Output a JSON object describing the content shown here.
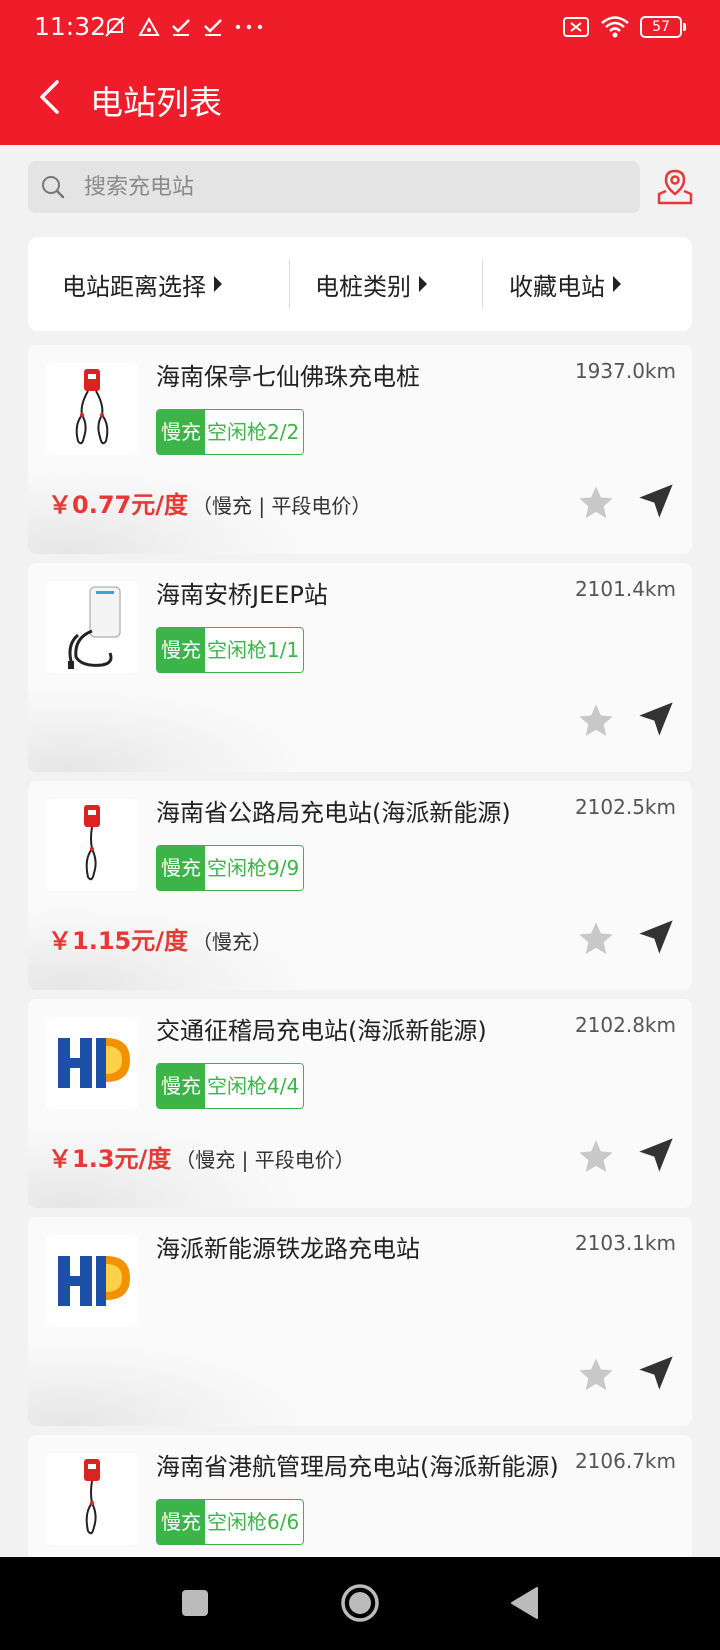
{
  "status_bar": {
    "time": "11:32",
    "battery": "57"
  },
  "header": {
    "title": "电站列表"
  },
  "search": {
    "placeholder": "搜索充电站"
  },
  "filters": [
    {
      "label": "电站距离选择"
    },
    {
      "label": "电桩类别"
    },
    {
      "label": "收藏电站"
    }
  ],
  "stations": [
    {
      "name": "海南保亭七仙佛珠充电桩",
      "distance": "1937.0km",
      "type": "慢充",
      "free": "空闲枪2/2",
      "price": "￥0.77元/度",
      "price_note": "（慢充 | 平段电价）",
      "thumb": "red-charger-two-cables"
    },
    {
      "name": "海南安桥JEEP站",
      "distance": "2101.4km",
      "type": "慢充",
      "free": "空闲枪1/1",
      "price": "",
      "price_note": "",
      "thumb": "white-wallbox"
    },
    {
      "name": "海南省公路局充电站(海派新能源)",
      "distance": "2102.5km",
      "type": "慢充",
      "free": "空闲枪9/9",
      "price": "￥1.15元/度",
      "price_note": "（慢充）",
      "thumb": "red-charger-one-cable"
    },
    {
      "name": "交通征稽局充电站(海派新能源)",
      "distance": "2102.8km",
      "type": "慢充",
      "free": "空闲枪4/4",
      "price": "￥1.3元/度",
      "price_note": "（慢充 | 平段电价）",
      "thumb": "hp-logo"
    },
    {
      "name": "海派新能源铁龙路充电站",
      "distance": "2103.1km",
      "type": "",
      "free": "",
      "price": "",
      "price_note": "",
      "thumb": "hp-logo"
    },
    {
      "name": "海南省港航管理局充电站(海派新能源)",
      "distance": "2106.7km",
      "type": "慢充",
      "free": "空闲枪6/6",
      "price": "",
      "price_note": "",
      "thumb": "red-charger-one-cable"
    }
  ],
  "colors": {
    "brand": "#ef1c2a",
    "badge_green": "#3cb449",
    "price_red": "#e53935"
  }
}
